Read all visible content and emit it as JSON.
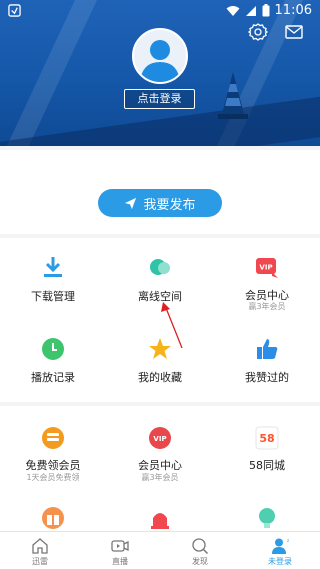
{
  "statusbar": {
    "time": "11:06"
  },
  "header": {
    "login_label": "点击登录"
  },
  "publish": {
    "label": "我要发布"
  },
  "grid1": {
    "items": [
      {
        "label": "下载管理",
        "sub": ""
      },
      {
        "label": "离线空间",
        "sub": ""
      },
      {
        "label": "会员中心",
        "sub": "赢3年会员"
      },
      {
        "label": "播放记录",
        "sub": ""
      },
      {
        "label": "我的收藏",
        "sub": ""
      },
      {
        "label": "我赞过的",
        "sub": ""
      }
    ]
  },
  "grid2": {
    "items": [
      {
        "label": "免费领会员",
        "sub": "1天会员免费领"
      },
      {
        "label": "会员中心",
        "sub": "赢3年会员"
      },
      {
        "label": "58同城",
        "sub": ""
      }
    ]
  },
  "tabs": [
    {
      "label": "迅雷"
    },
    {
      "label": "直播"
    },
    {
      "label": "发现"
    },
    {
      "label": "未登录"
    }
  ],
  "colors": {
    "accent": "#2b9be6",
    "header": "#1557a8"
  },
  "icons": {
    "vip_badge": "VIP",
    "tongcheng_logo": "58"
  }
}
